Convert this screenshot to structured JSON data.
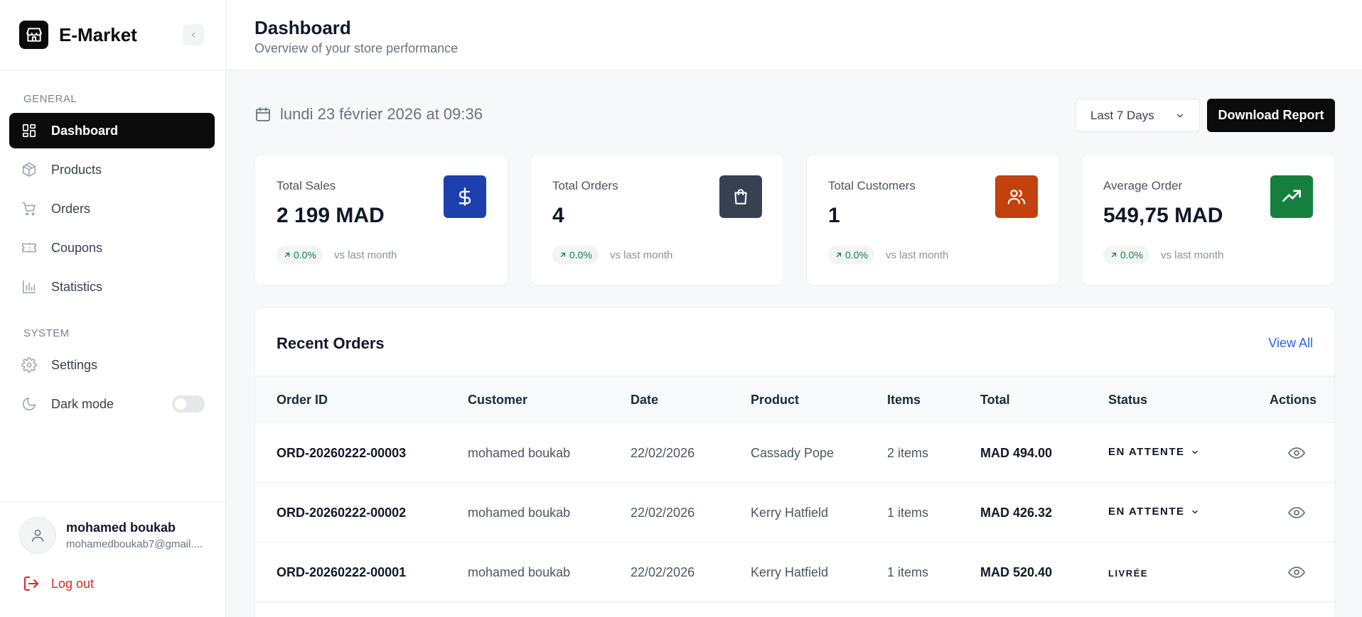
{
  "sidebar": {
    "brand": "E-Market",
    "sections": {
      "general": "GENERAL",
      "system": "SYSTEM"
    },
    "items": [
      {
        "label": "Dashboard",
        "icon": "dashboard-icon",
        "active": true
      },
      {
        "label": "Products",
        "icon": "box-icon"
      },
      {
        "label": "Orders",
        "icon": "cart-icon"
      },
      {
        "label": "Coupons",
        "icon": "ticket-icon"
      },
      {
        "label": "Statistics",
        "icon": "bar-chart-icon"
      }
    ],
    "system_items": [
      {
        "label": "Settings",
        "icon": "gear-icon"
      },
      {
        "label": "Dark mode",
        "icon": "moon-icon",
        "toggle": false
      }
    ],
    "user": {
      "name": "mohamed boukab",
      "email": "mohamedboukab7@gmail...."
    },
    "logout": "Log out"
  },
  "header": {
    "title": "Dashboard",
    "subtitle": "Overview of your store performance"
  },
  "toolbar": {
    "date": "lundi 23 février 2026 at 09:36",
    "range": "Last 7 Days",
    "download": "Download Report"
  },
  "stats": [
    {
      "title": "Total Sales",
      "value": "2 199 MAD",
      "trend": "0.0%",
      "note": "vs last month",
      "icon": "dollar-icon",
      "color": "#1e40af"
    },
    {
      "title": "Total Orders",
      "value": "4",
      "trend": "0.0%",
      "note": "vs last month",
      "icon": "shopping-bag-icon",
      "color": "#374151"
    },
    {
      "title": "Total Customers",
      "value": "1",
      "trend": "0.0%",
      "note": "vs last month",
      "icon": "users-icon",
      "color": "#c2410c"
    },
    {
      "title": "Average Order",
      "value": "549,75 MAD",
      "trend": "0.0%",
      "note": "vs last month",
      "icon": "trending-up-icon",
      "color": "#15803d"
    }
  ],
  "orders": {
    "title": "Recent Orders",
    "view_all": "View All",
    "columns": [
      "Order ID",
      "Customer",
      "Date",
      "Product",
      "Items",
      "Total",
      "Status",
      "Actions"
    ],
    "rows": [
      {
        "id": "ORD-20260222-00003",
        "customer": "mohamed boukab",
        "date": "22/02/2026",
        "product": "Cassady Pope",
        "items": "2 items",
        "total": "MAD 494.00",
        "status": "EN ATTENTE"
      },
      {
        "id": "ORD-20260222-00002",
        "customer": "mohamed boukab",
        "date": "22/02/2026",
        "product": "Kerry Hatfield",
        "items": "1 items",
        "total": "MAD 426.32",
        "status": "EN ATTENTE"
      },
      {
        "id": "ORD-20260222-00001",
        "customer": "mohamed boukab",
        "date": "22/02/2026",
        "product": "Kerry Hatfield",
        "items": "1 items",
        "total": "MAD 520.40",
        "status": "LIVRÉE"
      }
    ]
  }
}
